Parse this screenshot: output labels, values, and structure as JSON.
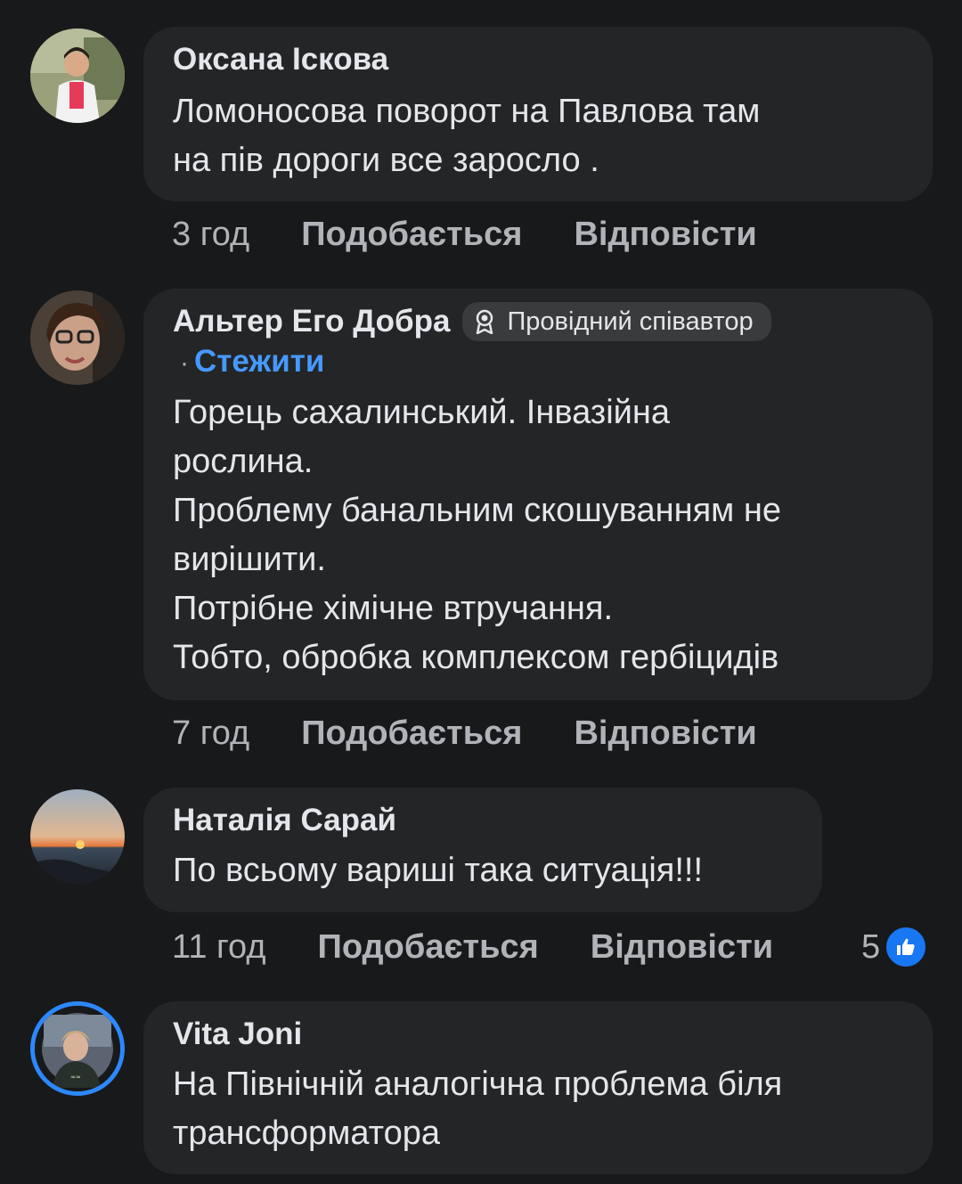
{
  "comments": [
    {
      "author": "Оксана Іскова",
      "text": "Ломоносова поворот на Павлова там\nна пів дороги все заросло .",
      "time": "3 год",
      "like_label": "Подобається",
      "reply_label": "Відповісти",
      "avatar_icon": "avatar-photo-woman"
    },
    {
      "author": "Альтер Его Добра",
      "badge": "Провідний співавтор",
      "badge_icon": "award-icon",
      "follow_label": "Стежити",
      "separator": "·",
      "text": "Горець сахалинський. Інвазійна\nрослина.\nПроблему банальним скошуванням не\nвирішити.\nПотрібне хімічне втручання.\nТобто, обробка комплексом гербіцидів",
      "time": "7 год",
      "like_label": "Подобається",
      "reply_label": "Відповісти",
      "avatar_icon": "avatar-photo-woman-glasses"
    },
    {
      "author": "Наталія Сарай",
      "text": "По всьому вариші така ситуація!!!",
      "time": "11 год",
      "like_label": "Подобається",
      "reply_label": "Відповісти",
      "reaction_count": "5",
      "reaction_icon": "like-icon",
      "avatar_icon": "avatar-photo-sunset"
    },
    {
      "author": "Vita Joni",
      "text": "На Північній аналогічна проблема біля\nтрансформатора",
      "avatar_icon": "avatar-photo-story-ring"
    }
  ],
  "colors": {
    "background": "#18191a",
    "bubble": "#242526",
    "text": "#e4e6eb",
    "secondary": "#b0b3b8",
    "link": "#4599ff",
    "like": "#1877f2"
  }
}
